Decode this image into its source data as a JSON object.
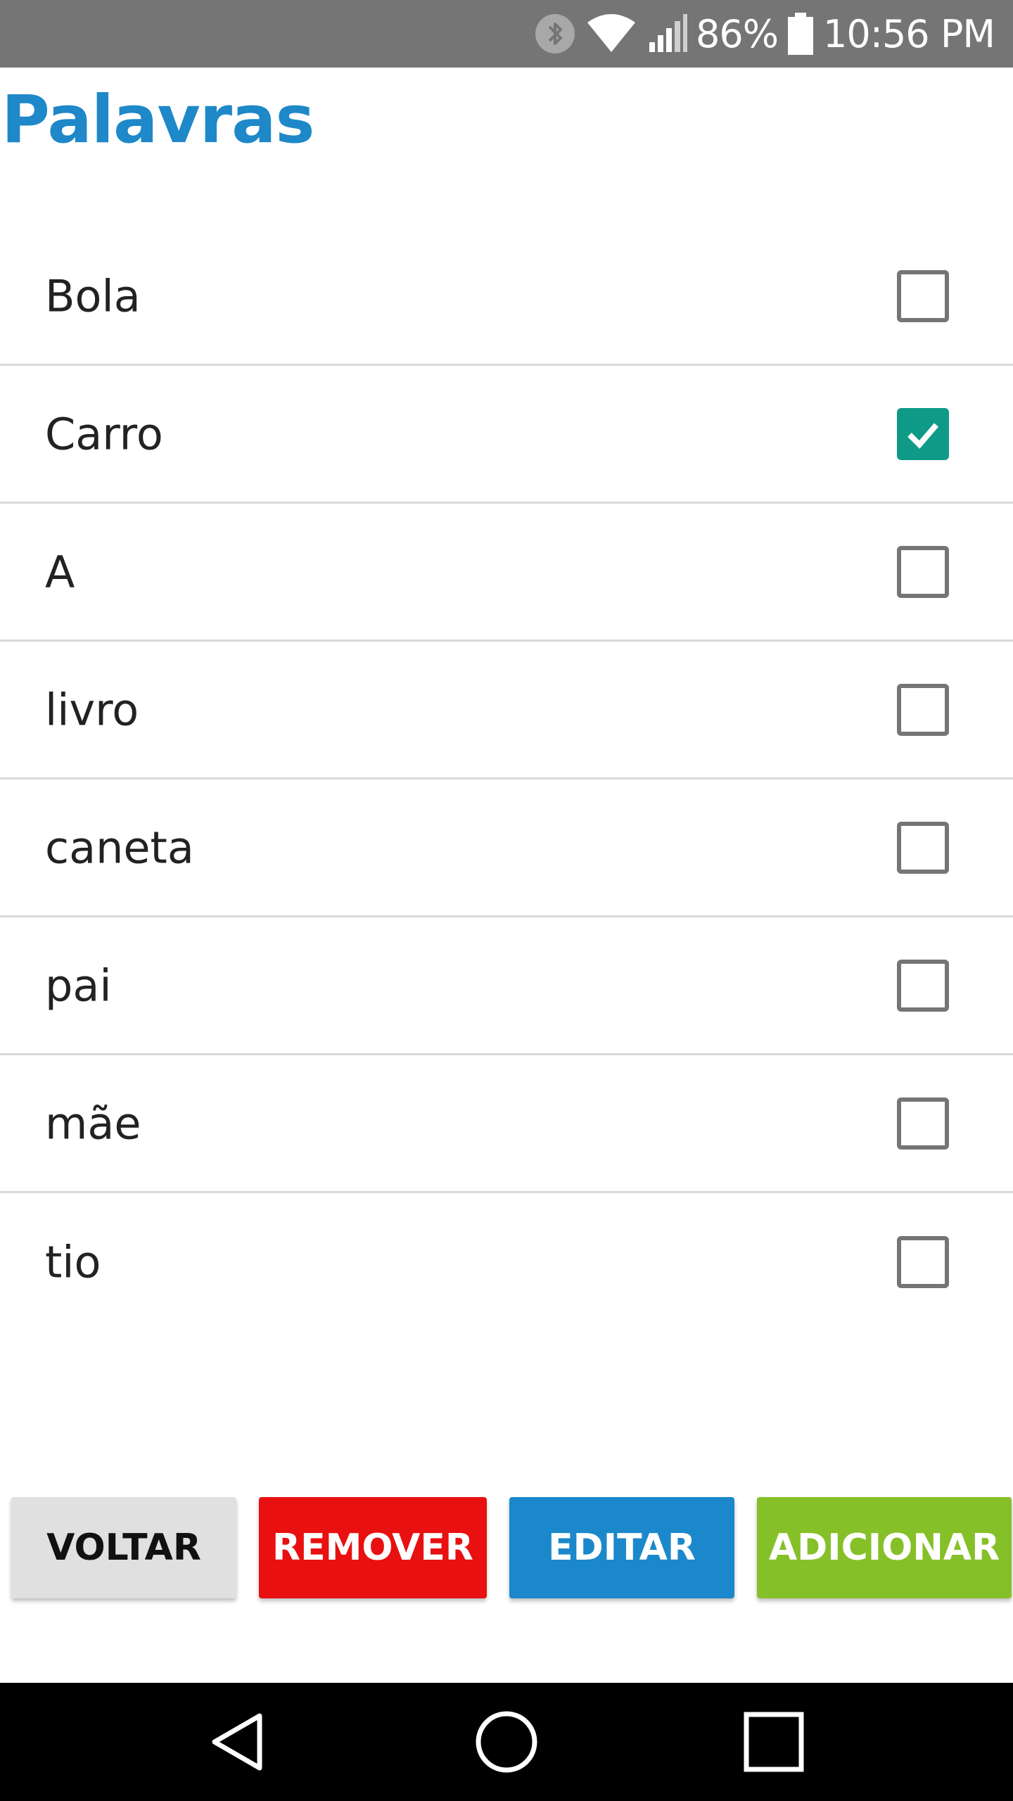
{
  "status_bar": {
    "battery_percent": "86%",
    "time": "10:56 PM",
    "icons": [
      "bluetooth-icon",
      "wifi-icon",
      "signal-icon",
      "battery-icon"
    ]
  },
  "page": {
    "title": "Palavras"
  },
  "words": [
    {
      "label": "Bola",
      "checked": false
    },
    {
      "label": "Carro",
      "checked": true
    },
    {
      "label": "A",
      "checked": false
    },
    {
      "label": "livro",
      "checked": false
    },
    {
      "label": "caneta",
      "checked": false
    },
    {
      "label": "pai",
      "checked": false
    },
    {
      "label": "mãe",
      "checked": false
    },
    {
      "label": "tio",
      "checked": false
    }
  ],
  "actions": {
    "back_label": "VOLTAR",
    "remove_label": "REMOVER",
    "edit_label": "EDITAR",
    "add_label": "ADICIONAR"
  },
  "nav_bar": {
    "icons": [
      "back-triangle-icon",
      "home-circle-icon",
      "recents-square-icon"
    ]
  },
  "colors": {
    "title": "#1e88c9",
    "checkbox_checked": "#0f9a88",
    "remove": "#e81010",
    "edit": "#1b88cb",
    "add": "#86c029",
    "back": "#e0e0e0",
    "status_bar": "#757575"
  }
}
